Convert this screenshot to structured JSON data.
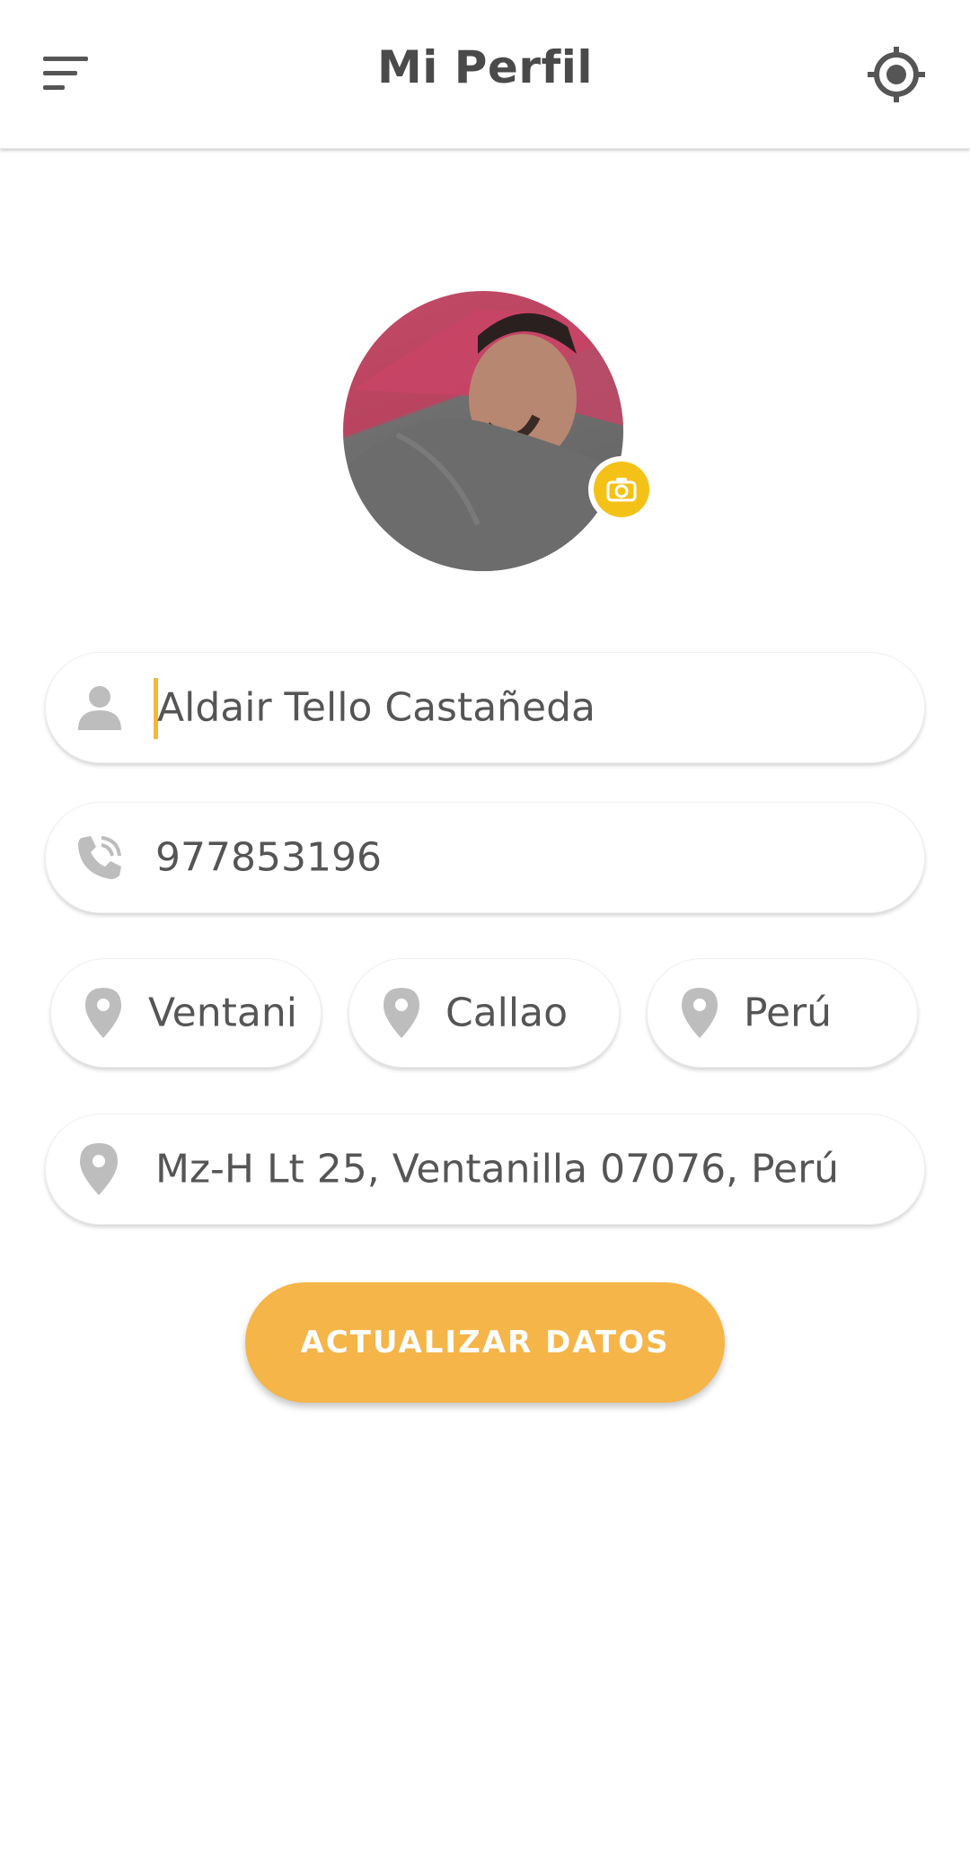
{
  "appbar": {
    "title": "Mi Perfil",
    "menu_icon": "sort-menu-icon",
    "locate_icon": "gps-target-icon"
  },
  "profile": {
    "avatar": "profile-photo",
    "camera_icon": "camera-icon"
  },
  "form": {
    "name": {
      "icon": "person-icon",
      "value": "Aldair Tello Castañeda"
    },
    "phone": {
      "icon": "phone-icon",
      "value": "977853196"
    },
    "district": {
      "icon": "location-pin-icon",
      "value": "Ventanilla"
    },
    "province": {
      "icon": "location-pin-icon",
      "value": "Callao"
    },
    "country": {
      "icon": "location-pin-icon",
      "value": "Perú"
    },
    "address": {
      "icon": "location-pin-icon",
      "value": "Mz-H Lt 25, Ventanilla 07076, Perú"
    }
  },
  "actions": {
    "update_label": "ACTUALIZAR DATOS"
  },
  "colors": {
    "accent": "#f5b548",
    "camera_badge": "#f4c217",
    "text": "#555555",
    "icon": "#bdbdbd"
  }
}
